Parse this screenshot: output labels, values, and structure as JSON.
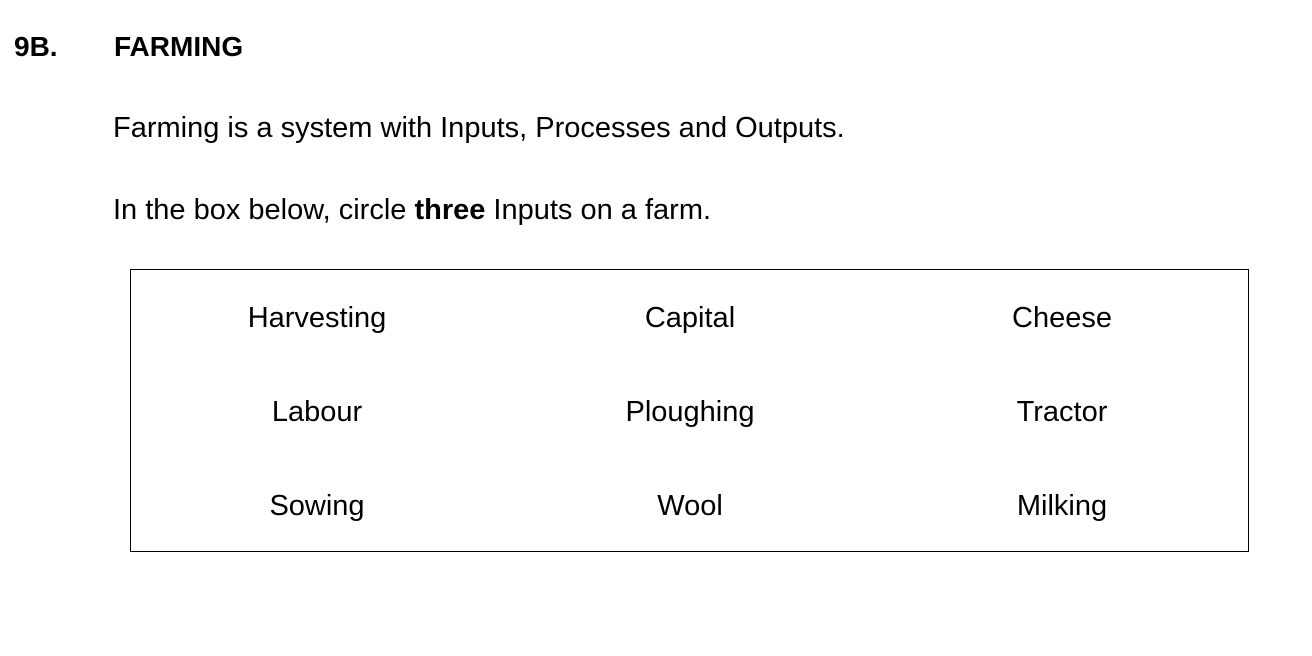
{
  "question": {
    "number": "9B.",
    "title": "FARMING"
  },
  "intro": "Farming is a system with Inputs, Processes and Outputs.",
  "instruction": {
    "before": "In the box below, circle ",
    "emphasis": "three",
    "after": " Inputs on a farm."
  },
  "options": [
    [
      "Harvesting",
      "Capital",
      "Cheese"
    ],
    [
      "Labour",
      "Ploughing",
      "Tractor"
    ],
    [
      "Sowing",
      "Wool",
      "Milking"
    ]
  ]
}
